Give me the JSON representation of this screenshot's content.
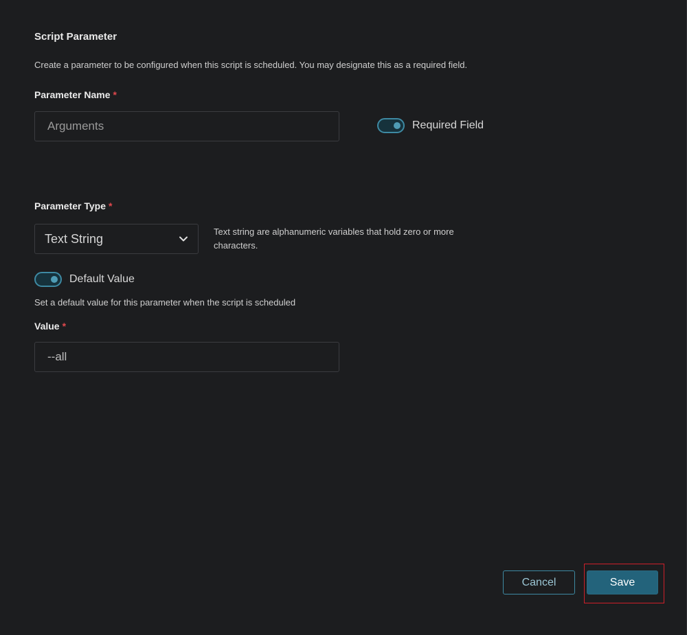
{
  "section": {
    "title": "Script Parameter",
    "description": "Create a parameter to be configured when this script is scheduled. You may designate this as a required field."
  },
  "parameter_name": {
    "label": "Parameter Name",
    "required_marker": "*",
    "placeholder": "Arguments",
    "value": ""
  },
  "required_field": {
    "label": "Required Field",
    "enabled": true
  },
  "parameter_type": {
    "label": "Parameter Type",
    "required_marker": "*",
    "selected": "Text String",
    "help": "Text string are alphanumeric variables that hold zero or more characters."
  },
  "default_value": {
    "toggle_label": "Default Value",
    "enabled": true,
    "description": "Set a default value for this parameter when the script is scheduled"
  },
  "value_field": {
    "label": "Value",
    "required_marker": "*",
    "value": "--all"
  },
  "actions": {
    "cancel_label": "Cancel",
    "save_label": "Save"
  },
  "colors": {
    "background": "#1c1d1f",
    "accent": "#23637b",
    "toggle_border": "#3e8aa3",
    "required": "#e0484d",
    "highlight": "#d0202a"
  },
  "icons": {
    "select_chevron": "chevron-down-icon"
  }
}
